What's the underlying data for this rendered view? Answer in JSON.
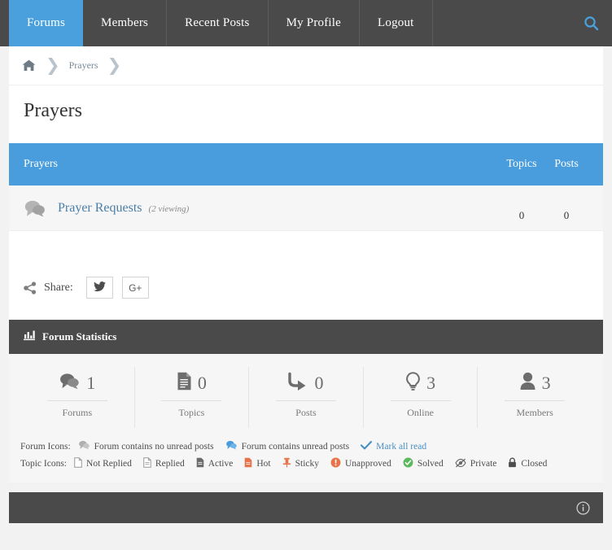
{
  "nav": {
    "items": [
      {
        "label": "Forums",
        "active": true
      },
      {
        "label": "Members",
        "active": false
      },
      {
        "label": "Recent Posts",
        "active": false
      },
      {
        "label": "My Profile",
        "active": false
      },
      {
        "label": "Logout",
        "active": false
      }
    ],
    "search_icon": "search-icon",
    "active_color": "#49a0dc",
    "bar_color": "#4a4a4a"
  },
  "breadcrumb": {
    "home_icon": "home-icon",
    "separator": "›",
    "items": [
      {
        "label": "Prayers"
      }
    ]
  },
  "page": {
    "title": "Prayers"
  },
  "forum_table": {
    "header": {
      "title": "Prayers",
      "topics": "Topics",
      "posts": "Posts",
      "bg_color": "#4a9ddc"
    },
    "rows": [
      {
        "icon": "forum-no-unread-icon",
        "name": "Prayer Requests",
        "viewing": "(2 viewing)",
        "topics": "0",
        "posts": "0"
      }
    ]
  },
  "share": {
    "icon": "share-nodes-icon",
    "label": "Share:",
    "buttons": [
      {
        "name": "twitter-share-button",
        "glyph": "twitter-icon"
      },
      {
        "name": "google-plus-share-button",
        "glyph": "G+"
      }
    ]
  },
  "statistics": {
    "icon": "bar-chart-icon",
    "title": "Forum Statistics",
    "items": [
      {
        "icon": "forums-icon",
        "value": "1",
        "label": "Forums"
      },
      {
        "icon": "topics-icon",
        "value": "0",
        "label": "Topics"
      },
      {
        "icon": "posts-icon",
        "value": "0",
        "label": "Posts"
      },
      {
        "icon": "online-icon",
        "value": "3",
        "label": "Online"
      },
      {
        "icon": "members-icon",
        "value": "3",
        "label": "Members"
      }
    ]
  },
  "legend": {
    "forum_icons_label": "Forum Icons:",
    "forum_items": [
      {
        "icon": "forum-no-unread-icon",
        "label": "Forum contains no unread posts",
        "color": "#b8b8b8"
      },
      {
        "icon": "forum-unread-icon",
        "label": "Forum contains unread posts",
        "color": "#4a9ddc"
      }
    ],
    "mark_all_read": "Mark all read",
    "mark_all_read_icon": "check-icon",
    "topic_icons_label": "Topic Icons:",
    "topic_items": [
      {
        "icon": "not-replied-icon",
        "label": "Not Replied",
        "color": "#9a9a9a"
      },
      {
        "icon": "replied-icon",
        "label": "Replied",
        "color": "#9a9a9a"
      },
      {
        "icon": "active-icon",
        "label": "Active",
        "color": "#6b6b6b"
      },
      {
        "icon": "hot-icon",
        "label": "Hot",
        "color": "#e8734a"
      },
      {
        "icon": "sticky-icon",
        "label": "Sticky",
        "color": "#e8734a"
      },
      {
        "icon": "unapproved-icon",
        "label": "Unapproved",
        "color": "#e8734a"
      },
      {
        "icon": "solved-icon",
        "label": "Solved",
        "color": "#5cb85c"
      },
      {
        "icon": "private-icon",
        "label": "Private",
        "color": "#6b6b6b"
      },
      {
        "icon": "closed-icon",
        "label": "Closed",
        "color": "#4d4d4d"
      }
    ]
  },
  "footer": {
    "info_icon": "info-circle-icon"
  }
}
